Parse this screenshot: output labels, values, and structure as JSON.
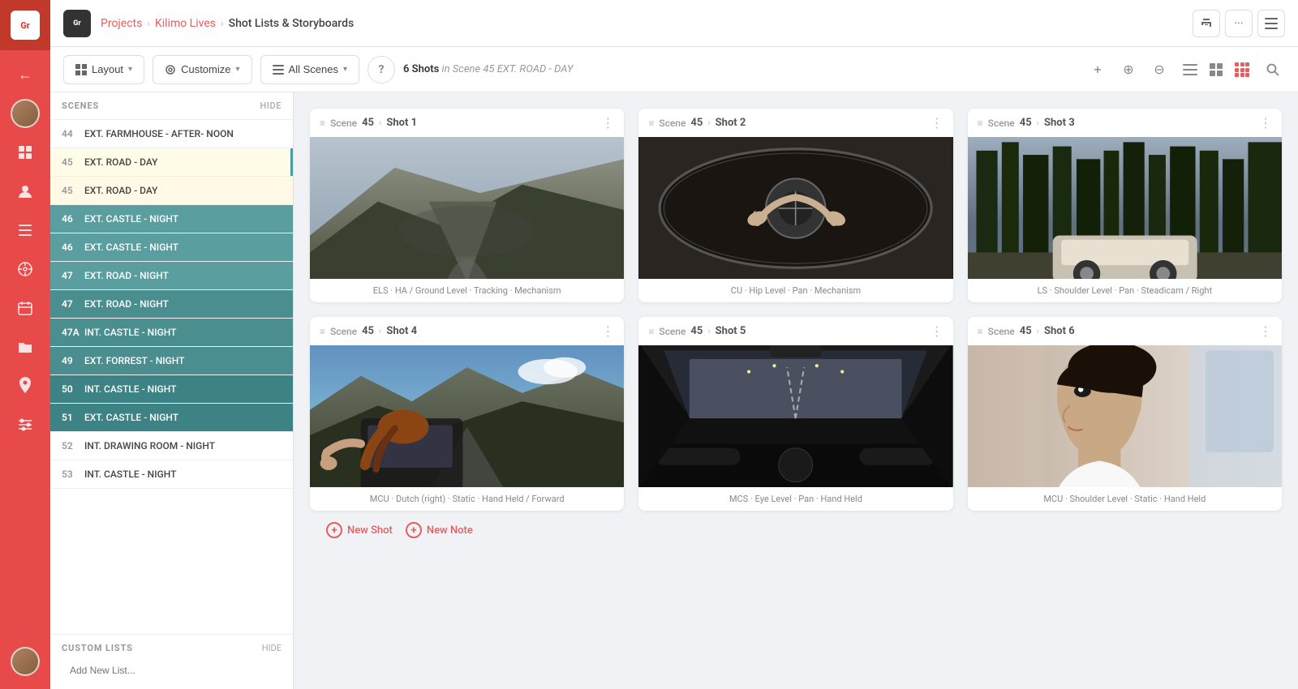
{
  "app": {
    "logo_text": "Gr",
    "title": "Shot Lists & Storyboards"
  },
  "breadcrumb": {
    "projects": "Projects",
    "project": "Kilimo Lives",
    "current": "Shot Lists & Storyboards"
  },
  "toolbar": {
    "layout_label": "Layout",
    "customize_label": "Customize",
    "all_scenes_label": "All Scenes",
    "help_label": "?",
    "shot_count": "6",
    "shot_count_prefix": "Shots",
    "scene_info": "in Scene 45 EXT. ROAD - DAY"
  },
  "scenes": {
    "header": "SCENES",
    "hide_label": "HIDE",
    "items": [
      {
        "num": "44",
        "name": "EXT. FARMHOUSE - AFTER- NOON",
        "style": "normal"
      },
      {
        "num": "45",
        "name": "EXT. ROAD - DAY",
        "style": "active-light"
      },
      {
        "num": "45",
        "name": "EXT. ROAD - DAY",
        "style": "active-light2"
      },
      {
        "num": "46",
        "name": "EXT. CASTLE - NIGHT",
        "style": "teal"
      },
      {
        "num": "46",
        "name": "EXT. CASTLE - NIGHT",
        "style": "teal"
      },
      {
        "num": "47",
        "name": "EXT. ROAD - NIGHT",
        "style": "teal"
      },
      {
        "num": "47",
        "name": "EXT. ROAD - NIGHT",
        "style": "teal2"
      },
      {
        "num": "47A",
        "name": "INT. CASTLE - NIGHT",
        "style": "teal2"
      },
      {
        "num": "49",
        "name": "EXT. FORREST - NIGHT",
        "style": "teal2"
      },
      {
        "num": "50",
        "name": "INT. CASTLE - NIGHT",
        "style": "teal3"
      },
      {
        "num": "51",
        "name": "EXT. CASTLE - NIGHT",
        "style": "teal3"
      },
      {
        "num": "52",
        "name": "INT. DRAWING ROOM - NIGHT",
        "style": "normal"
      },
      {
        "num": "53",
        "name": "INT. CASTLE - NIGHT",
        "style": "normal"
      }
    ]
  },
  "custom_lists": {
    "header": "CUSTOM LISTS",
    "hide_label": "HIDE",
    "input_placeholder": "Add New List..."
  },
  "shots": [
    {
      "scene": "45",
      "shot": "Shot 1",
      "image_class": "img-road",
      "caption": "ELS · HA / Ground Level · Tracking · Mechanism"
    },
    {
      "scene": "45",
      "shot": "Shot 2",
      "image_class": "img-steering",
      "caption": "CU · Hip Level · Pan · Mechanism"
    },
    {
      "scene": "45",
      "shot": "Shot 3",
      "image_class": "img-forest",
      "caption": "LS · Shoulder Level · Pan · Steadicam / Right"
    },
    {
      "scene": "45",
      "shot": "Shot 4",
      "image_class": "img-mountain",
      "caption": "MCU · Dutch (right) · Static · Hand Held / Forward"
    },
    {
      "scene": "45",
      "shot": "Shot 5",
      "image_class": "img-dashboard",
      "caption": "MCS · Eye Level · Pan · Hand Held"
    },
    {
      "scene": "45",
      "shot": "Shot 6",
      "image_class": "img-profile",
      "caption": "MCU · Shoulder Level · Static · Hand Held"
    }
  ],
  "add_buttons": {
    "new_shot": "New Shot",
    "new_note": "New Note"
  },
  "nav": {
    "icons": [
      {
        "name": "back-arrow",
        "symbol": "←"
      },
      {
        "name": "avatar",
        "symbol": ""
      },
      {
        "name": "dashboard-icon",
        "symbol": "⊞"
      },
      {
        "name": "users-icon",
        "symbol": "👤"
      },
      {
        "name": "list-icon",
        "symbol": "☰"
      },
      {
        "name": "settings-icon",
        "symbol": "✱"
      },
      {
        "name": "calendar-icon",
        "symbol": "📅"
      },
      {
        "name": "folder-icon",
        "symbol": "📁"
      },
      {
        "name": "location-icon",
        "symbol": "📍"
      },
      {
        "name": "sliders-icon",
        "symbol": "⚙"
      }
    ]
  }
}
